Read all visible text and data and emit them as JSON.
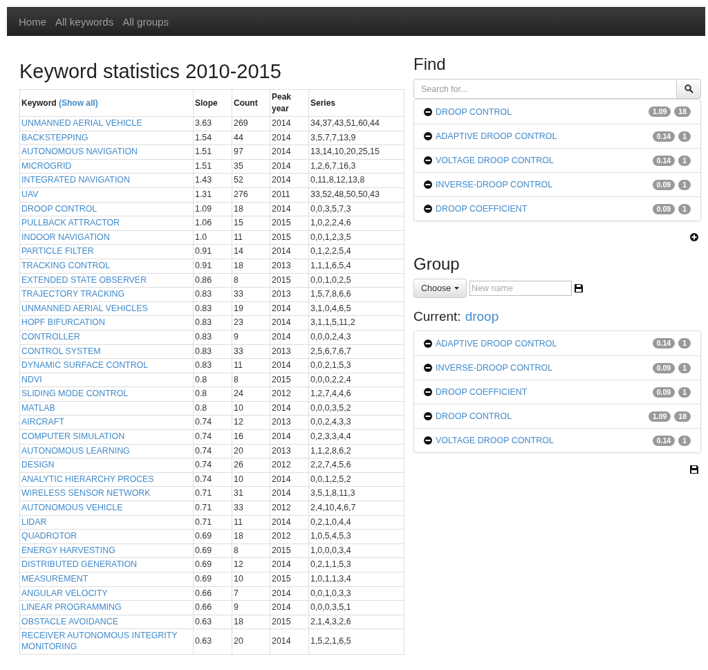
{
  "navbar": {
    "links": [
      "Home",
      "All keywords",
      "All groups"
    ]
  },
  "main": {
    "title": "Keyword statistics 2010-2015",
    "table": {
      "columns": [
        {
          "label": "Keyword",
          "link": "(Show all)"
        },
        {
          "label": "Slope"
        },
        {
          "label": "Count"
        },
        {
          "label": "Peak year"
        },
        {
          "label": "Series"
        }
      ],
      "rows": [
        [
          "UNMANNED AERIAL VEHICLE",
          "3.63",
          "269",
          "2014",
          "34,37,43,51,60,44"
        ],
        [
          "BACKSTEPPING",
          "1.54",
          "44",
          "2014",
          "3,5,7,7,13,9"
        ],
        [
          "AUTONOMOUS NAVIGATION",
          "1.51",
          "97",
          "2014",
          "13,14,10,20,25,15"
        ],
        [
          "MICROGRID",
          "1.51",
          "35",
          "2014",
          "1,2,6,7,16,3"
        ],
        [
          "INTEGRATED NAVIGATION",
          "1.43",
          "52",
          "2014",
          "0,11,8,12,13,8"
        ],
        [
          "UAV",
          "1.31",
          "276",
          "2011",
          "33,52,48,50,50,43"
        ],
        [
          "DROOP CONTROL",
          "1.09",
          "18",
          "2014",
          "0,0,3,5,7,3"
        ],
        [
          "PULLBACK ATTRACTOR",
          "1.06",
          "15",
          "2015",
          "1,0,2,2,4,6"
        ],
        [
          "INDOOR NAVIGATION",
          "1.0",
          "11",
          "2015",
          "0,0,1,2,3,5"
        ],
        [
          "PARTICLE FILTER",
          "0.91",
          "14",
          "2014",
          "0,1,2,2,5,4"
        ],
        [
          "TRACKING CONTROL",
          "0.91",
          "18",
          "2013",
          "1,1,1,6,5,4"
        ],
        [
          "EXTENDED STATE OBSERVER",
          "0.86",
          "8",
          "2015",
          "0,0,1,0,2,5"
        ],
        [
          "TRAJECTORY TRACKING",
          "0.83",
          "33",
          "2013",
          "1,5,7,8,6,6"
        ],
        [
          "UNMANNED AERIAL VEHICLES",
          "0.83",
          "19",
          "2014",
          "3,1,0,4,6,5"
        ],
        [
          "HOPF BIFURCATION",
          "0.83",
          "23",
          "2014",
          "3,1,1,5,11,2"
        ],
        [
          "CONTROLLER",
          "0.83",
          "9",
          "2014",
          "0,0,0,2,4,3"
        ],
        [
          "CONTROL SYSTEM",
          "0.83",
          "33",
          "2013",
          "2,5,6,7,6,7"
        ],
        [
          "DYNAMIC SURFACE CONTROL",
          "0.83",
          "11",
          "2014",
          "0,0,2,1,5,3"
        ],
        [
          "NDVI",
          "0.8",
          "8",
          "2015",
          "0,0,0,2,2,4"
        ],
        [
          "SLIDING MODE CONTROL",
          "0.8",
          "24",
          "2012",
          "1,2,7,4,4,6"
        ],
        [
          "MATLAB",
          "0.8",
          "10",
          "2014",
          "0,0,0,3,5,2"
        ],
        [
          "AIRCRAFT",
          "0.74",
          "12",
          "2013",
          "0,0,2,4,3,3"
        ],
        [
          "COMPUTER SIMULATION",
          "0.74",
          "16",
          "2014",
          "0,2,3,3,4,4"
        ],
        [
          "AUTONOMOUS LEARNING",
          "0.74",
          "20",
          "2013",
          "1,1,2,8,6,2"
        ],
        [
          "DESIGN",
          "0.74",
          "26",
          "2012",
          "2,2,7,4,5,6"
        ],
        [
          "ANALYTIC HIERARCHY PROCES",
          "0.74",
          "10",
          "2014",
          "0,0,1,2,5,2"
        ],
        [
          "WIRELESS SENSOR NETWORK",
          "0.71",
          "31",
          "2014",
          "3,5,1,8,11,3"
        ],
        [
          "AUTONOMOUS VEHICLE",
          "0.71",
          "33",
          "2012",
          "2,4,10,4,6,7"
        ],
        [
          "LIDAR",
          "0.71",
          "11",
          "2014",
          "0,2,1,0,4,4"
        ],
        [
          "QUADROTOR",
          "0.69",
          "18",
          "2012",
          "1,0,5,4,5,3"
        ],
        [
          "ENERGY HARVESTING",
          "0.69",
          "8",
          "2015",
          "1,0,0,0,3,4"
        ],
        [
          "DISTRIBUTED GENERATION",
          "0.69",
          "12",
          "2014",
          "0,2,1,1,5,3"
        ],
        [
          "MEASUREMENT",
          "0.69",
          "10",
          "2015",
          "1,0,1,1,3,4"
        ],
        [
          "ANGULAR VELOCITY",
          "0.66",
          "7",
          "2014",
          "0,0,1,0,3,3"
        ],
        [
          "LINEAR PROGRAMMING",
          "0.66",
          "9",
          "2014",
          "0,0,0,3,5,1"
        ],
        [
          "OBSTACLE AVOIDANCE",
          "0.63",
          "18",
          "2015",
          "2,1,4,3,2,6"
        ],
        [
          "RECEIVER AUTONOMOUS INTEGRITY MONITORING",
          "0.63",
          "20",
          "2014",
          "1,5,2,1,6,5"
        ]
      ]
    }
  },
  "find": {
    "title": "Find",
    "search": {
      "placeholder": "Search for..."
    },
    "items": [
      {
        "label": "DROOP CONTROL",
        "slope": "1.09",
        "count": "18"
      },
      {
        "label": "ADAPTIVE DROOP CONTROL",
        "slope": "0.14",
        "count": "1"
      },
      {
        "label": "VOLTAGE DROOP CONTROL",
        "slope": "0.14",
        "count": "1"
      },
      {
        "label": "INVERSE-DROOP CONTROL",
        "slope": "0.09",
        "count": "1"
      },
      {
        "label": "DROOP COEFFICIENT",
        "slope": "0.09",
        "count": "1"
      }
    ]
  },
  "group": {
    "title": "Group",
    "choose": "Choose",
    "new_name": {
      "placeholder": "New name"
    },
    "current_label": "Current:",
    "current_name": "droop",
    "items": [
      {
        "label": "ADAPTIVE DROOP CONTROL",
        "slope": "0.14",
        "count": "1"
      },
      {
        "label": "INVERSE-DROOP CONTROL",
        "slope": "0.09",
        "count": "1"
      },
      {
        "label": "DROOP COEFFICIENT",
        "slope": "0.09",
        "count": "1"
      },
      {
        "label": "DROOP CONTROL",
        "slope": "1.09",
        "count": "18"
      },
      {
        "label": "VOLTAGE DROOP CONTROL",
        "slope": "0.14",
        "count": "1"
      }
    ]
  }
}
